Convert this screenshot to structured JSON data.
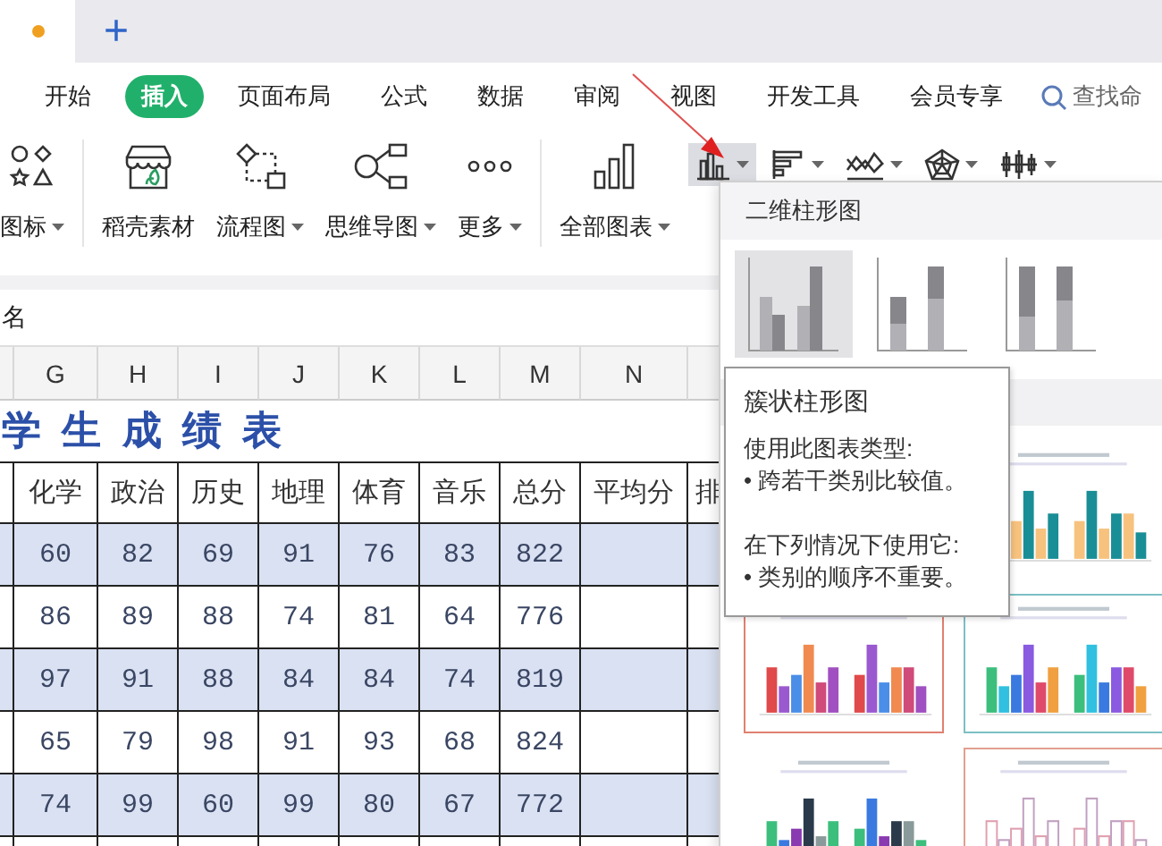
{
  "document_tabs": {
    "new_tab": "+"
  },
  "menu": [
    {
      "label": "开始",
      "selected": false
    },
    {
      "label": "插入",
      "selected": true
    },
    {
      "label": "页面布局",
      "selected": false
    },
    {
      "label": "公式",
      "selected": false
    },
    {
      "label": "数据",
      "selected": false
    },
    {
      "label": "审阅",
      "selected": false
    },
    {
      "label": "视图",
      "selected": false
    },
    {
      "label": "开发工具",
      "selected": false
    },
    {
      "label": "会员专享",
      "selected": false
    }
  ],
  "search": {
    "label": "查找命"
  },
  "toolbar": [
    {
      "kind": "shapes",
      "label": "图标",
      "dropdown": true
    },
    {
      "kind": "store",
      "label": "稻壳素材",
      "dropdown": false
    },
    {
      "kind": "flow",
      "label": "流程图",
      "dropdown": true
    },
    {
      "kind": "mindmap",
      "label": "思维导图",
      "dropdown": true
    },
    {
      "kind": "more",
      "label": "更多",
      "dropdown": true
    },
    {
      "kind": "allcharts",
      "label": "全部图表",
      "dropdown": true
    }
  ],
  "chart_buttons": [
    {
      "kind": "column",
      "selected": true
    },
    {
      "kind": "bar",
      "selected": false
    },
    {
      "kind": "line",
      "selected": false
    },
    {
      "kind": "radar",
      "selected": false
    },
    {
      "kind": "stock",
      "selected": false
    }
  ],
  "name_box": "名",
  "sheet": {
    "columns": [
      "G",
      "H",
      "I",
      "J",
      "K",
      "L",
      "M",
      "N"
    ],
    "title": "学 生 成 绩 表",
    "headers": [
      "化学",
      "政治",
      "历史",
      "地理",
      "体育",
      "音乐",
      "总分",
      "平均分",
      "排"
    ],
    "rows": [
      {
        "highlighted": true,
        "cells": [
          "60",
          "82",
          "69",
          "91",
          "76",
          "83",
          "822"
        ]
      },
      {
        "highlighted": false,
        "cells": [
          "86",
          "89",
          "88",
          "74",
          "81",
          "64",
          "776"
        ]
      },
      {
        "highlighted": true,
        "cells": [
          "97",
          "91",
          "88",
          "84",
          "84",
          "74",
          "819"
        ]
      },
      {
        "highlighted": false,
        "cells": [
          "65",
          "79",
          "98",
          "91",
          "93",
          "68",
          "824"
        ]
      },
      {
        "highlighted": true,
        "cells": [
          "74",
          "99",
          "60",
          "99",
          "80",
          "67",
          "772"
        ]
      }
    ]
  },
  "chart_panel": {
    "title": "二维柱形图",
    "subtypes": [
      {
        "kind": "clustered",
        "selected": true
      },
      {
        "kind": "stacked",
        "selected": false
      },
      {
        "kind": "percent",
        "selected": false
      }
    ],
    "tooltip": {
      "title": "簇状柱形图",
      "sections": [
        {
          "lines": [
            "使用此图表类型:",
            "• 跨若干类别比较值。"
          ]
        },
        {
          "lines": [
            "在下列情况下使用它:",
            "• 类别的顺序不重要。"
          ]
        }
      ]
    }
  }
}
